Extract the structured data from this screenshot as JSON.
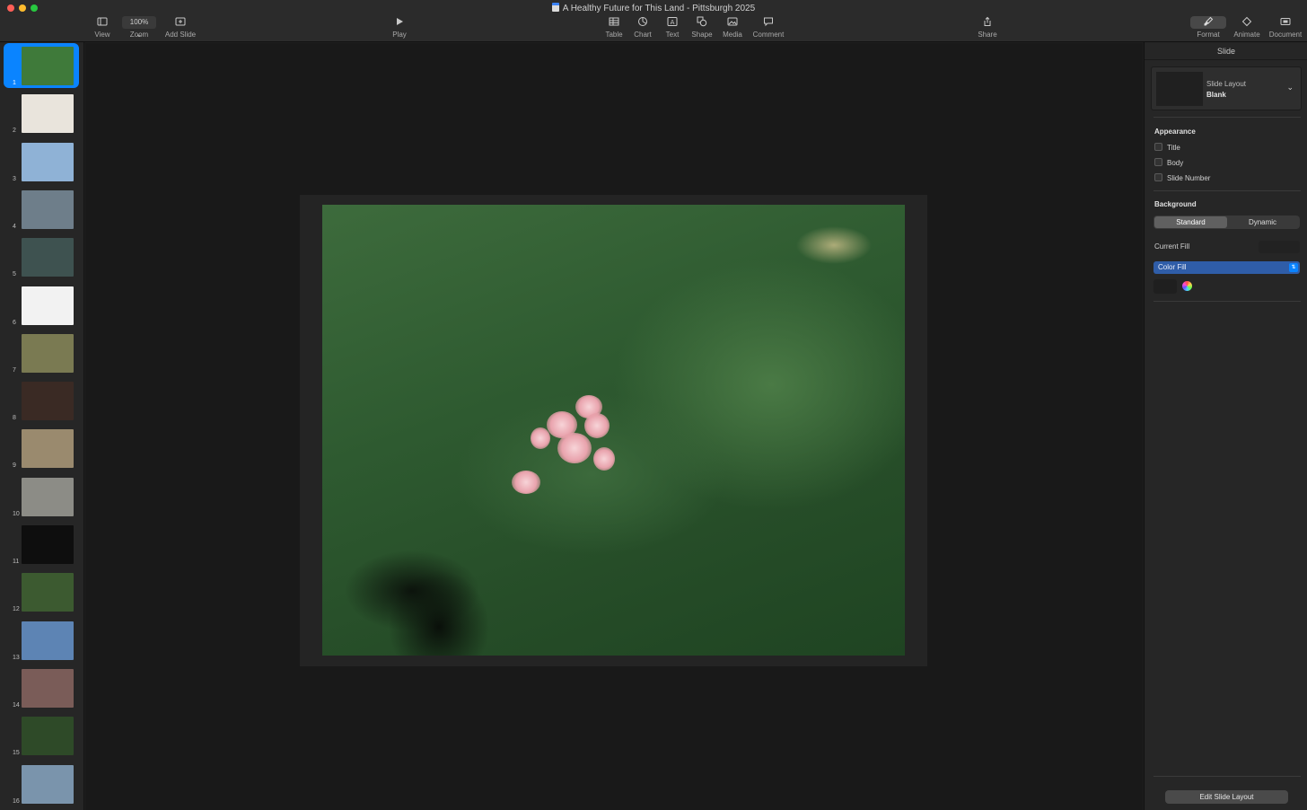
{
  "window": {
    "title": "A Healthy Future for This Land - Pittsburgh 2025"
  },
  "toolbar": {
    "view": "View",
    "zoom_value": "100%",
    "zoom": "Zoom",
    "add_slide": "Add Slide",
    "play": "Play",
    "table": "Table",
    "chart": "Chart",
    "text": "Text",
    "shape": "Shape",
    "media": "Media",
    "comment": "Comment",
    "share": "Share",
    "format": "Format",
    "animate": "Animate",
    "document": "Document"
  },
  "navigator": {
    "selected": 1,
    "slides": [
      {
        "num": "1",
        "color": "#3f7a3a"
      },
      {
        "num": "2",
        "color": "#e9e4dc"
      },
      {
        "num": "3",
        "color": "#8fb2d6"
      },
      {
        "num": "4",
        "color": "#6e7e8a"
      },
      {
        "num": "5",
        "color": "#3e5250"
      },
      {
        "num": "6",
        "color": "#f2f2f2"
      },
      {
        "num": "7",
        "color": "#7a7a52"
      },
      {
        "num": "8",
        "color": "#3a2a24"
      },
      {
        "num": "9",
        "color": "#9a8a6e"
      },
      {
        "num": "10",
        "color": "#8c8c86"
      },
      {
        "num": "11",
        "color": "#0e0e0e"
      },
      {
        "num": "12",
        "color": "#3c5a30"
      },
      {
        "num": "13",
        "color": "#5d84b4"
      },
      {
        "num": "14",
        "color": "#7a5c58"
      },
      {
        "num": "15",
        "color": "#2e4a28"
      },
      {
        "num": "16",
        "color": "#7a94ac"
      }
    ]
  },
  "inspector": {
    "tab": "Slide",
    "layout_label": "Slide Layout",
    "layout_value": "Blank",
    "appearance": "Appearance",
    "title": "Title",
    "body": "Body",
    "slide_number": "Slide Number",
    "background": "Background",
    "standard": "Standard",
    "dynamic": "Dynamic",
    "current_fill": "Current Fill",
    "fill_type": "Color Fill",
    "edit_layout": "Edit Slide Layout"
  }
}
